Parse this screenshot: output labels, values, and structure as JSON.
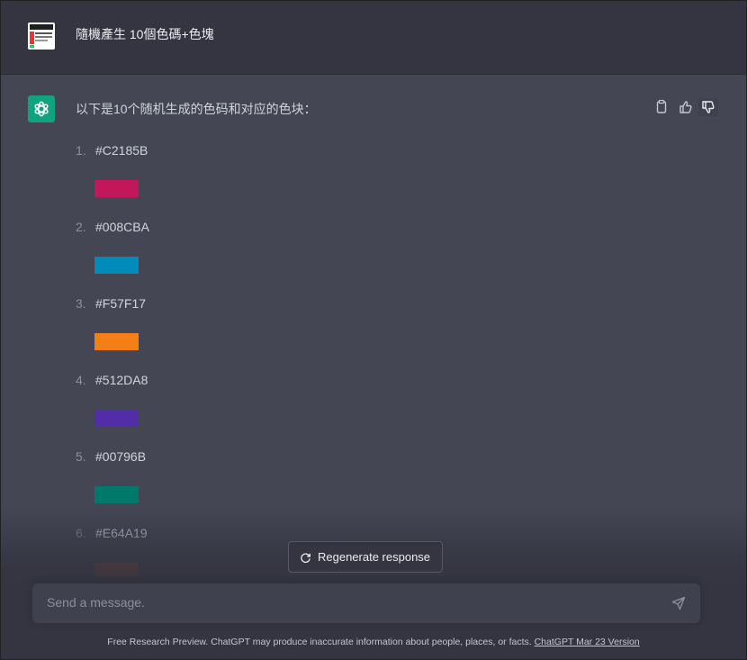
{
  "user_message": {
    "text": "隨機產生 10個色碼+色塊"
  },
  "assistant": {
    "intro": "以下是10个随机生成的色码和对应的色块：",
    "items": [
      {
        "num": "1.",
        "code": "#C2185B",
        "color": "#C2185B"
      },
      {
        "num": "2.",
        "code": "#008CBA",
        "color": "#008CBA"
      },
      {
        "num": "3.",
        "code": "#F57F17",
        "color": "#F57F17"
      },
      {
        "num": "4.",
        "code": "#512DA8",
        "color": "#512DA8"
      },
      {
        "num": "5.",
        "code": "#00796B",
        "color": "#00796B"
      },
      {
        "num": "6.",
        "code": "#E64A19",
        "color": "#E64A19"
      }
    ],
    "actions": [
      "copy-icon",
      "thumbs-up-icon",
      "thumbs-down-icon"
    ]
  },
  "regenerate": {
    "label": "Regenerate response",
    "icon": "refresh-icon"
  },
  "composer": {
    "placeholder": "Send a message.",
    "send_icon": "send-icon"
  },
  "footer": {
    "text": "Free Research Preview. ChatGPT may produce inaccurate information about people, places, or facts.",
    "link": "ChatGPT Mar 23 Version"
  },
  "colors": {
    "page_bg": "#444654",
    "user_bg": "#343541",
    "accent": "#10a37f",
    "input_bg": "#40414f"
  }
}
